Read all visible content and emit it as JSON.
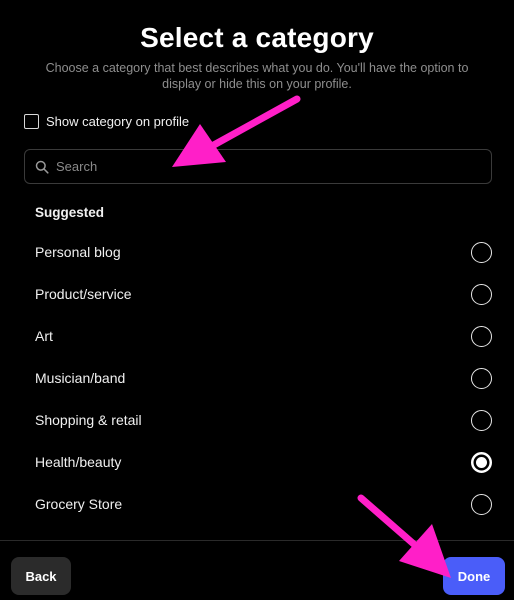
{
  "header": {
    "title": "Select a category",
    "subtitle": "Choose a category that best describes what you do. You'll have the option to display or hide this on your profile."
  },
  "show_category": {
    "label": "Show category on profile",
    "checked": false
  },
  "search": {
    "placeholder": "Search",
    "value": ""
  },
  "suggested_heading": "Suggested",
  "options": [
    {
      "label": "Personal blog",
      "selected": false
    },
    {
      "label": "Product/service",
      "selected": false
    },
    {
      "label": "Art",
      "selected": false
    },
    {
      "label": "Musician/band",
      "selected": false
    },
    {
      "label": "Shopping & retail",
      "selected": false
    },
    {
      "label": "Health/beauty",
      "selected": true
    },
    {
      "label": "Grocery Store",
      "selected": false
    }
  ],
  "footer": {
    "back_label": "Back",
    "done_label": "Done"
  },
  "colors": {
    "background": "#000000",
    "accent": "#4a5df9",
    "annotation_arrow": "#ff1fc8",
    "back_button": "#2b2b2b"
  },
  "annotations": [
    "arrow-to-search",
    "arrow-to-done"
  ]
}
